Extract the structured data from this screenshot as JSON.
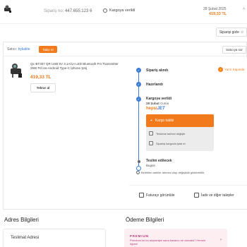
{
  "header": {
    "order_label": "Sipariş no:",
    "order_number": "447.655.123 6",
    "status": "Kargoya verildi",
    "date": "28 Şubat 2025",
    "price": "419,33 TL",
    "chevron": "^"
  },
  "hide_button": {
    "label": "Siparişi gizle",
    "aux": "⊘"
  },
  "seller": {
    "label": "Satıcı:",
    "name": "bykalite",
    "follow_label": "Takip et",
    "ask_label": "Satıcıya sor"
  },
  "product": {
    "title": "QL-BT307 QR USB 5V 3.1A/1A LED Bluetooth Fm Transmitter 25W Pd Ios-Android Type-C İphone Şarj",
    "price": "419,33 TL",
    "review_label": "Tekrar al"
  },
  "timeline": {
    "fast_badge": "Yarın Kapında",
    "steps": [
      {
        "label": "Sipariş alındı"
      },
      {
        "label": "Hazırlandı"
      },
      {
        "label": "Kargoya verildi",
        "sub_date": "28 Şubat",
        "sub_day": "Cuma"
      },
      {
        "label": "Teslim edilecek",
        "sub": "Bugün"
      }
    ],
    "carrier": {
      "part1": "hepsi",
      "part2": "JET"
    },
    "track_label": "Kargo takibi",
    "actions": [
      "Teslimat tarihini değiştir",
      "Siparişi kargoda iptal et"
    ],
    "info": "Belirtilen tarihler tahmini olup değişiklik gösterebilir."
  },
  "bottom_actions": {
    "invoice": "Faturayı görüntüle",
    "returns": "İade ve diğer talepler"
  },
  "address": {
    "section_title": "Adres Bilgileri",
    "card_title": "Teslimat Adresi"
  },
  "payment": {
    "section_title": "Ödeme Bilgileri",
    "premium_head": "PREMIUM",
    "premium_text": "Premium'un bu alışverişte sana kazancı ne olacaktı? Hemen öğren!"
  },
  "colors": {
    "accent": "#f27a1a",
    "blue": "#3c7ed4",
    "premium": "#b63a7a"
  }
}
